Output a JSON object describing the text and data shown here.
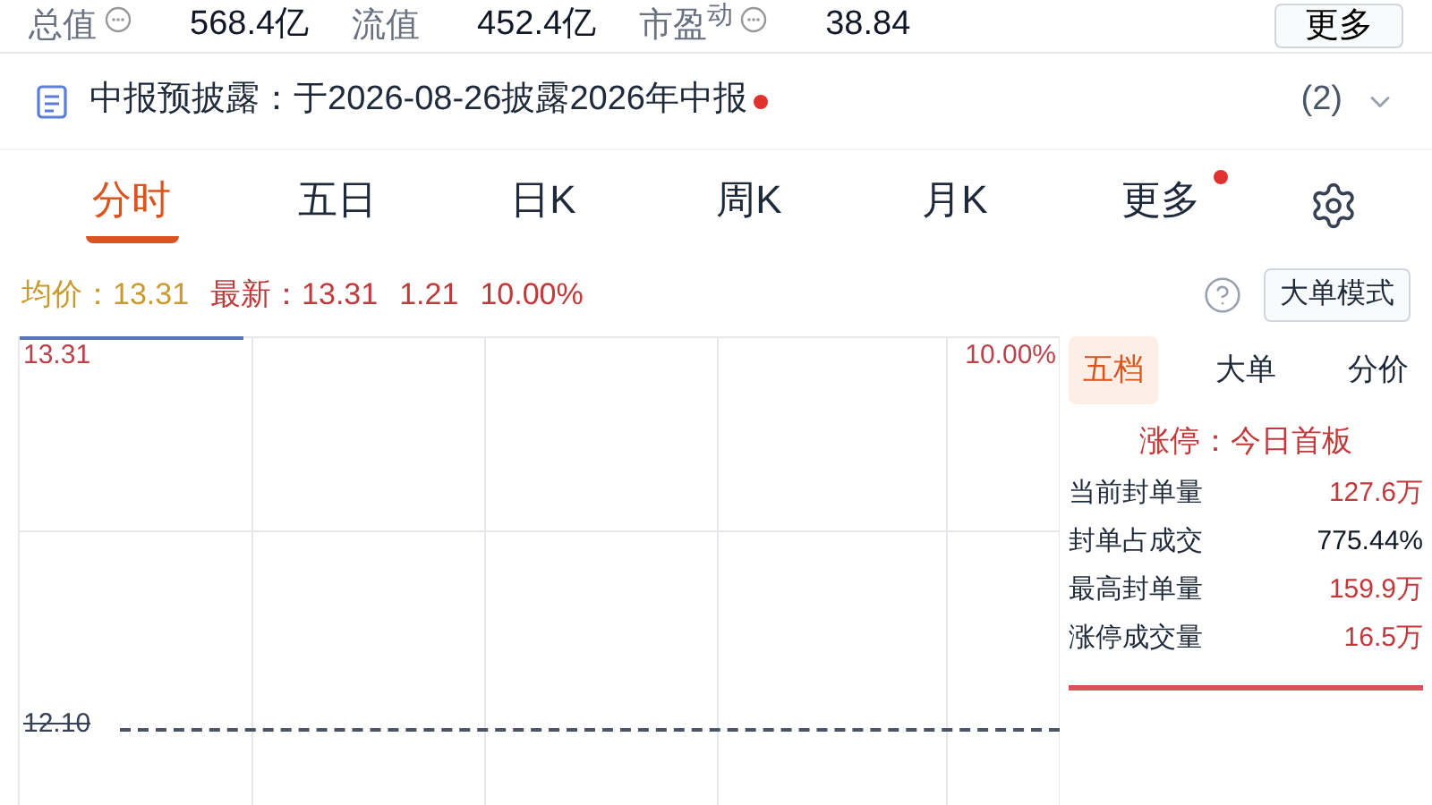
{
  "stats": [
    {
      "label": "总值",
      "value": "568.4亿",
      "info": true
    },
    {
      "label": "流值",
      "value": "452.4亿",
      "info": false
    },
    {
      "label": "市盈$^{动}$",
      "value": "38.84",
      "info": true
    }
  ],
  "more_button": "更多",
  "notice": {
    "text": "中报预披露：于2026-08-26披露2026年中报",
    "unread": true,
    "count": "(2)"
  },
  "tabs": [
    {
      "label": "分时",
      "selected": true,
      "badge": false
    },
    {
      "label": "五日",
      "selected": false,
      "badge": false
    },
    {
      "label": "日K",
      "selected": false,
      "badge": false
    },
    {
      "label": "周K",
      "selected": false,
      "badge": false
    },
    {
      "label": "月K",
      "selected": false,
      "badge": false
    },
    {
      "label": "更多",
      "selected": false,
      "badge": true
    }
  ],
  "quote": {
    "avg_label": "均价：",
    "avg": "13.31",
    "last_label": "最新：",
    "last": "13.31",
    "change": "1.21",
    "change_pct": "10.00%"
  },
  "mode_button": "大单模式",
  "chart": {
    "top_price": "13.31",
    "top_pct": "10.00%",
    "prev_close": "12.10"
  },
  "panel": {
    "tabs": [
      {
        "label": "五档",
        "selected": true
      },
      {
        "label": "大单",
        "selected": false
      },
      {
        "label": "分价",
        "selected": false
      }
    ],
    "title": "涨停：今日首板",
    "rows": [
      {
        "label": "当前封单量",
        "value": "127.6万",
        "highlight": true
      },
      {
        "label": "封单占成交",
        "value": "775.44%",
        "highlight": false
      },
      {
        "label": "最高封单量",
        "value": "159.9万",
        "highlight": true
      },
      {
        "label": "涨停成交量",
        "value": "16.5万",
        "highlight": true
      }
    ]
  }
}
